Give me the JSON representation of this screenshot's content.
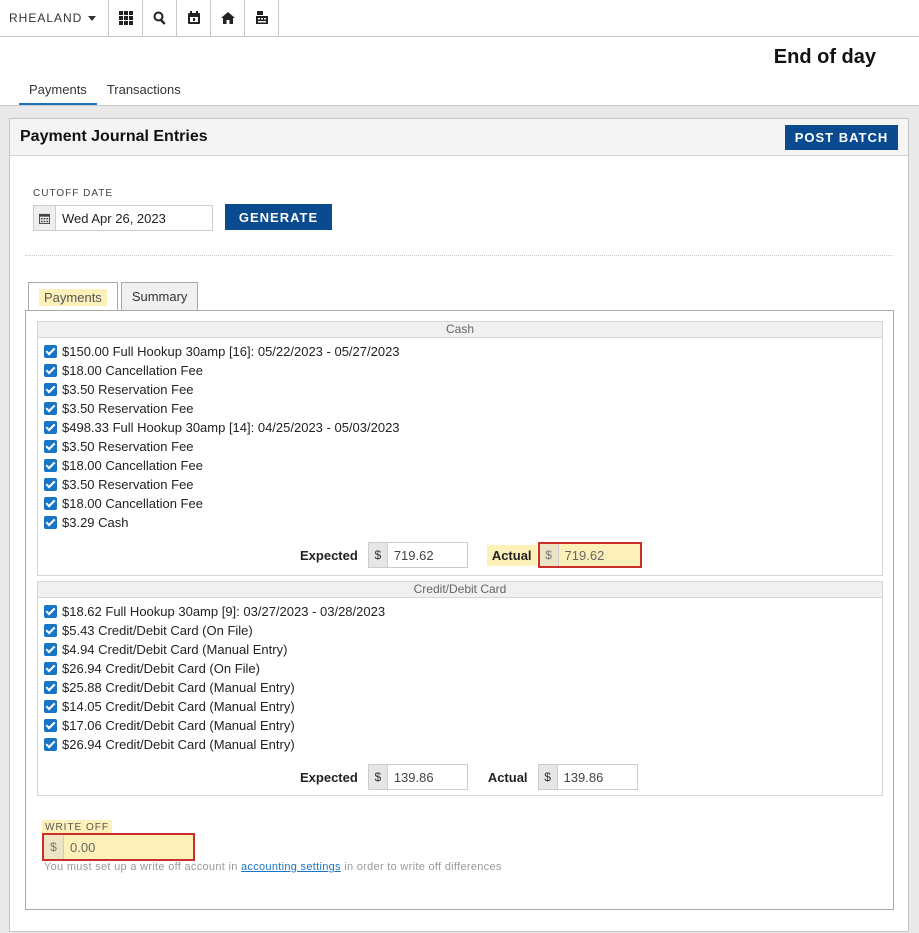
{
  "topbar": {
    "brand": "RHEALAND",
    "icons": [
      "grid-icon",
      "search-icon",
      "calendar-icon",
      "home-icon",
      "register-icon"
    ]
  },
  "page": {
    "title": "End of day"
  },
  "top_tabs": [
    {
      "label": "Payments",
      "active": true
    },
    {
      "label": "Transactions",
      "active": false
    }
  ],
  "panel": {
    "title": "Payment Journal Entries",
    "post_batch_label": "POST BATCH",
    "cutoff_label": "CUTOFF DATE",
    "cutoff_value": "Wed Apr 26, 2023",
    "generate_label": "GENERATE"
  },
  "sub_tabs": [
    {
      "label": "Payments",
      "active": true
    },
    {
      "label": "Summary",
      "active": false
    }
  ],
  "cash": {
    "heading": "Cash",
    "items": [
      "$150.00 Full Hookup 30amp [16]: 05/22/2023 - 05/27/2023",
      "$18.00 Cancellation Fee",
      "$3.50 Reservation Fee",
      "$3.50 Reservation Fee",
      "$498.33 Full Hookup 30amp [14]: 04/25/2023 - 05/03/2023",
      "$3.50 Reservation Fee",
      "$18.00 Cancellation Fee",
      "$3.50 Reservation Fee",
      "$18.00 Cancellation Fee",
      "$3.29 Cash"
    ],
    "expected_label": "Expected",
    "expected_value": "719.62",
    "actual_label": "Actual",
    "actual_value": "719.62"
  },
  "card": {
    "heading": "Credit/Debit Card",
    "items": [
      "$18.62 Full Hookup 30amp [9]: 03/27/2023 - 03/28/2023",
      "$5.43 Credit/Debit Card (On File)",
      "$4.94 Credit/Debit Card (Manual Entry)",
      "$26.94 Credit/Debit Card (On File)",
      "$25.88 Credit/Debit Card (Manual Entry)",
      "$14.05 Credit/Debit Card (Manual Entry)",
      "$17.06 Credit/Debit Card (Manual Entry)",
      "$26.94 Credit/Debit Card (Manual Entry)"
    ],
    "expected_label": "Expected",
    "expected_value": "139.86",
    "actual_label": "Actual",
    "actual_value": "139.86"
  },
  "currency_symbol": "$",
  "writeoff": {
    "label": "WRITE OFF",
    "value": "0.00",
    "note_before": "You must set up a write off account in ",
    "note_link": "accounting settings",
    "note_after": " in order to write off differences"
  },
  "colors": {
    "primary": "#0a4a8e",
    "checkbox": "#1a74c4",
    "highlight": "#fdf0b8",
    "error_border": "#c9302c"
  }
}
